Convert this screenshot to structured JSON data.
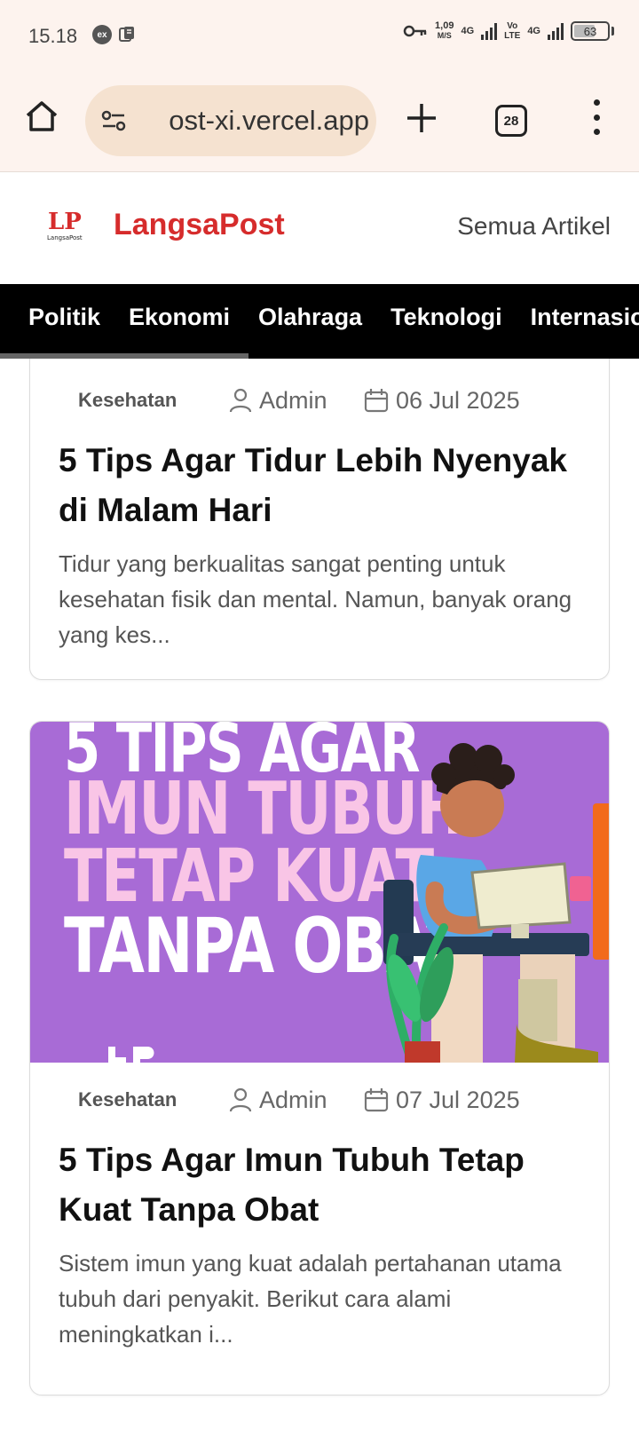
{
  "status_bar": {
    "time": "15.18",
    "net_speed_value": "1,09",
    "net_speed_unit": "M/S",
    "net1": "4G",
    "net2_top": "Vo",
    "net2_bottom": "LTE",
    "net3": "4G",
    "battery": "63",
    "battery_level": 0.63
  },
  "browser": {
    "url": "ost-xi.vercel.app",
    "tab_count": "28"
  },
  "site": {
    "logo_letters": "LP",
    "logo_caption": "LangsaPost",
    "brand": "LangsaPost",
    "all_articles": "Semua Artikel",
    "brand_color": "#d62c2c"
  },
  "categories": [
    "Politik",
    "Ekonomi",
    "Olahraga",
    "Teknologi",
    "Internasional"
  ],
  "articles": [
    {
      "category": "Kesehatan",
      "author": "Admin",
      "date": "06 Jul 2025",
      "title": "5 Tips Agar Tidur Lebih Nyenyak di Malam Hari",
      "excerpt": "Tidur yang berkualitas sangat penting untuk kesehatan fisik dan mental. Namun, banyak orang yang kes..."
    },
    {
      "category": "Kesehatan",
      "author": "Admin",
      "date": "07 Jul 2025",
      "title": "5 Tips Agar Imun Tubuh Tetap Kuat Tanpa Obat",
      "excerpt": "Sistem imun yang kuat adalah pertahanan utama tubuh dari penyakit. Berikut cara alami meningkatkan i...",
      "image_lines": [
        "5 TIPS AGAR",
        "IMUN TUBUH",
        "TETAP KUAT",
        "TANPA OBAT"
      ],
      "image_bg": "#a86bd6"
    }
  ]
}
